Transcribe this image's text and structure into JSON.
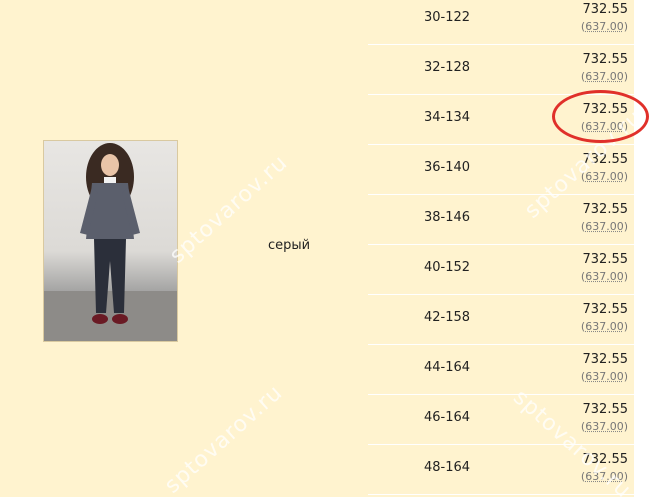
{
  "product": {
    "color": "серый"
  },
  "rows": [
    {
      "size": "30-122",
      "price": "732.55",
      "old_price": "637.00"
    },
    {
      "size": "32-128",
      "price": "732.55",
      "old_price": "637.00"
    },
    {
      "size": "34-134",
      "price": "732.55",
      "old_price": "637.00"
    },
    {
      "size": "36-140",
      "price": "732.55",
      "old_price": "637.00"
    },
    {
      "size": "38-146",
      "price": "732.55",
      "old_price": "637.00"
    },
    {
      "size": "40-152",
      "price": "732.55",
      "old_price": "637.00"
    },
    {
      "size": "42-158",
      "price": "732.55",
      "old_price": "637.00"
    },
    {
      "size": "44-164",
      "price": "732.55",
      "old_price": "637.00"
    },
    {
      "size": "46-164",
      "price": "732.55",
      "old_price": "637.00"
    },
    {
      "size": "48-164",
      "price": "732.55",
      "old_price": "637.00"
    }
  ],
  "watermark": "sptovarov.ru",
  "paren_open": "(",
  "paren_close": ")",
  "colors": {
    "background": "#fff3cf",
    "highlight_circle": "#e0302a"
  }
}
